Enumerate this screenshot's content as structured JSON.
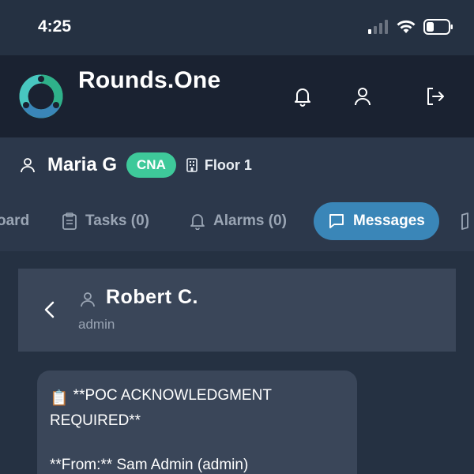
{
  "status_bar": {
    "time": "4:25",
    "icons": [
      "signal-icon",
      "wifi-icon",
      "battery-icon"
    ]
  },
  "app": {
    "title": "Rounds.One",
    "header_icons": [
      "bell-icon",
      "user-icon",
      "logout-icon"
    ],
    "accent_color": "#3ec99a",
    "brand_blue": "#3a86b8"
  },
  "user": {
    "name": "Maria G",
    "role": "CNA",
    "floor": "Floor 1"
  },
  "tabs": [
    {
      "label": "oard",
      "icon": "dashboard-icon",
      "active": false
    },
    {
      "label": "Tasks (0)",
      "icon": "clipboard-icon",
      "active": false
    },
    {
      "label": "Alarms (0)",
      "icon": "bell-icon",
      "active": false
    },
    {
      "label": "Messages",
      "icon": "message-icon",
      "active": true
    },
    {
      "label": "",
      "icon": "book-icon",
      "active": false
    }
  ],
  "chat": {
    "contact_name": "Robert C.",
    "contact_role": "admin"
  },
  "messages": [
    {
      "emoji": "📋",
      "line1": "**POC ACKNOWLEDGMENT",
      "line2": "REQUIRED**",
      "line3": "",
      "line4": "**From:** Sam Admin (admin)"
    }
  ]
}
